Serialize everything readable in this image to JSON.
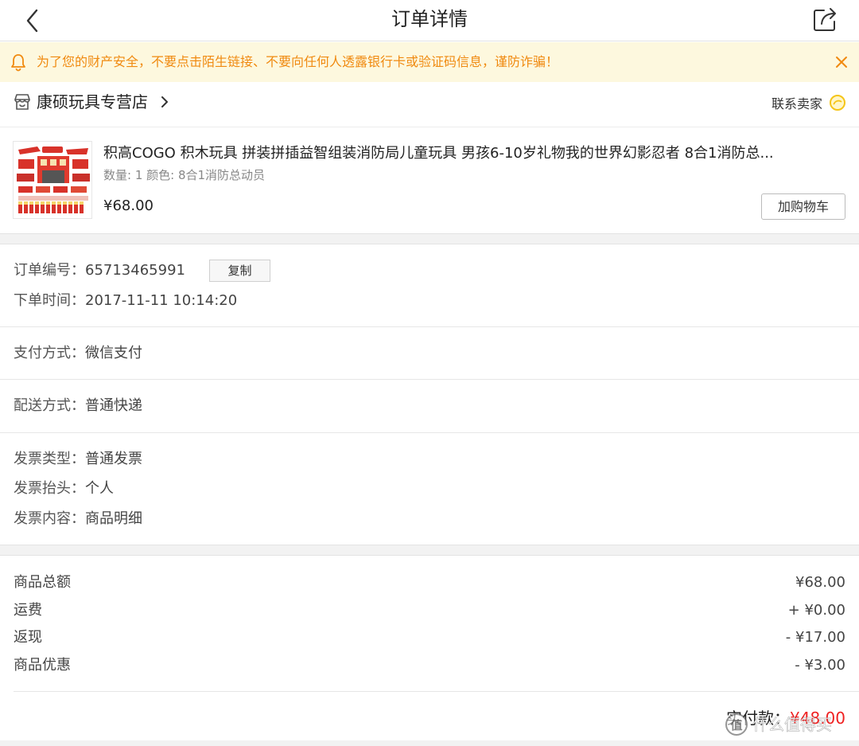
{
  "navbar": {
    "title": "订单详情",
    "back_icon": "chevron-left-icon",
    "share_icon": "share-icon"
  },
  "notice": {
    "text": "为了您的财产安全，不要点击陌生链接、不要向任何人透露银行卡或验证码信息，谨防诈骗！",
    "text_color": "#f08a10",
    "background": "#fdf8de"
  },
  "store": {
    "name": "康硕玩具专营店",
    "contact_label": "联系卖家"
  },
  "product": {
    "title": "积高COGO 积木玩具 拼装拼插益智组装消防局儿童玩具 男孩6-10岁礼物我的世界幻影忍者 8合1消防总...",
    "spec": "数量: 1 颜色: 8合1消防总动员",
    "price": "¥68.00",
    "cart_button": "加购物车"
  },
  "order_info": {
    "order_no_label": "订单编号：",
    "order_no": "65713465991",
    "copy_button": "复制",
    "time_label": "下单时间：",
    "time": "2017-11-11 10:14:20"
  },
  "payment": {
    "label": "支付方式：",
    "value": "微信支付"
  },
  "delivery": {
    "label": "配送方式：",
    "value": "普通快递"
  },
  "invoice": {
    "type_label": "发票类型：",
    "type": "普通发票",
    "title_label": "发票抬头：",
    "title": "个人",
    "content_label": "发票内容：",
    "content": "商品明细"
  },
  "amounts": [
    {
      "label": "商品总额",
      "value": "¥68.00"
    },
    {
      "label": "运费",
      "value": "+ ¥0.00"
    },
    {
      "label": "返现",
      "value": "- ¥17.00"
    },
    {
      "label": "商品优惠",
      "value": "- ¥3.00"
    }
  ],
  "total": {
    "label": "实付款：",
    "value": "¥48.00",
    "value_color": "#ef2020"
  },
  "watermark": {
    "text": "什么值得买"
  }
}
